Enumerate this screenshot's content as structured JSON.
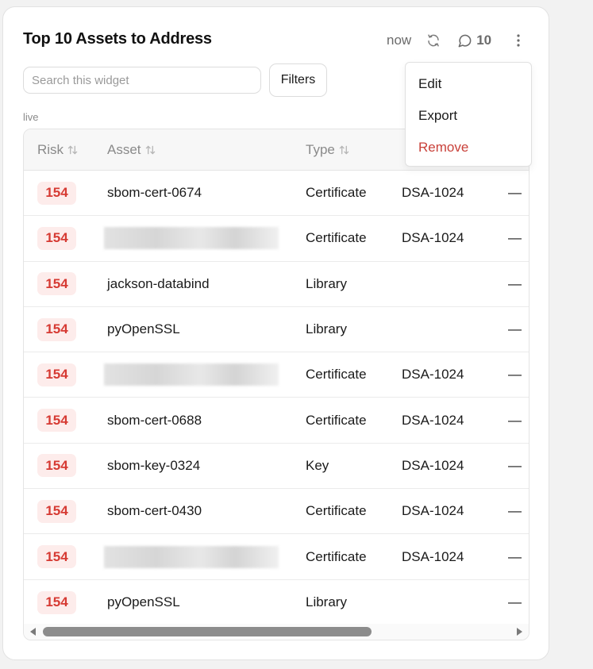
{
  "widget": {
    "title": "Top 10 Assets to Address",
    "updated_label": "now",
    "comment_count": "10"
  },
  "search": {
    "placeholder": "Search this widget",
    "value": ""
  },
  "filters_label": "Filters",
  "status_label": "live",
  "table": {
    "columns": [
      {
        "label": "Risk",
        "sortable": true
      },
      {
        "label": "Asset",
        "sortable": true
      },
      {
        "label": "Type",
        "sortable": true
      }
    ],
    "rows": [
      {
        "risk": "154",
        "asset": "sbom-cert-0674",
        "redacted": false,
        "type": "Certificate",
        "algorithm": "DSA-1024",
        "extra": "—"
      },
      {
        "risk": "154",
        "asset": "",
        "redacted": true,
        "type": "Certificate",
        "algorithm": "DSA-1024",
        "extra": "—"
      },
      {
        "risk": "154",
        "asset": "jackson-databind",
        "redacted": false,
        "type": "Library",
        "algorithm": "",
        "extra": "—"
      },
      {
        "risk": "154",
        "asset": "pyOpenSSL",
        "redacted": false,
        "type": "Library",
        "algorithm": "",
        "extra": "—"
      },
      {
        "risk": "154",
        "asset": "",
        "redacted": true,
        "type": "Certificate",
        "algorithm": "DSA-1024",
        "extra": "—"
      },
      {
        "risk": "154",
        "asset": "sbom-cert-0688",
        "redacted": false,
        "type": "Certificate",
        "algorithm": "DSA-1024",
        "extra": "—"
      },
      {
        "risk": "154",
        "asset": "sbom-key-0324",
        "redacted": false,
        "type": "Key",
        "algorithm": "DSA-1024",
        "extra": "—"
      },
      {
        "risk": "154",
        "asset": "sbom-cert-0430",
        "redacted": false,
        "type": "Certificate",
        "algorithm": "DSA-1024",
        "extra": "—"
      },
      {
        "risk": "154",
        "asset": "",
        "redacted": true,
        "type": "Certificate",
        "algorithm": "DSA-1024",
        "extra": "—"
      },
      {
        "risk": "154",
        "asset": "pyOpenSSL",
        "redacted": false,
        "type": "Library",
        "algorithm": "",
        "extra": "—"
      }
    ]
  },
  "menu": {
    "items": [
      {
        "label": "Edit",
        "danger": false
      },
      {
        "label": "Export",
        "danger": false
      },
      {
        "label": "Remove",
        "danger": true
      }
    ]
  },
  "colors": {
    "risk_text": "#d63a33",
    "risk_bg": "#fdeceb",
    "danger": "#c9413a"
  },
  "icons": {
    "refresh": "refresh-icon",
    "comment": "comment-icon",
    "more": "more-vertical-icon",
    "sort": "sort-icon"
  }
}
